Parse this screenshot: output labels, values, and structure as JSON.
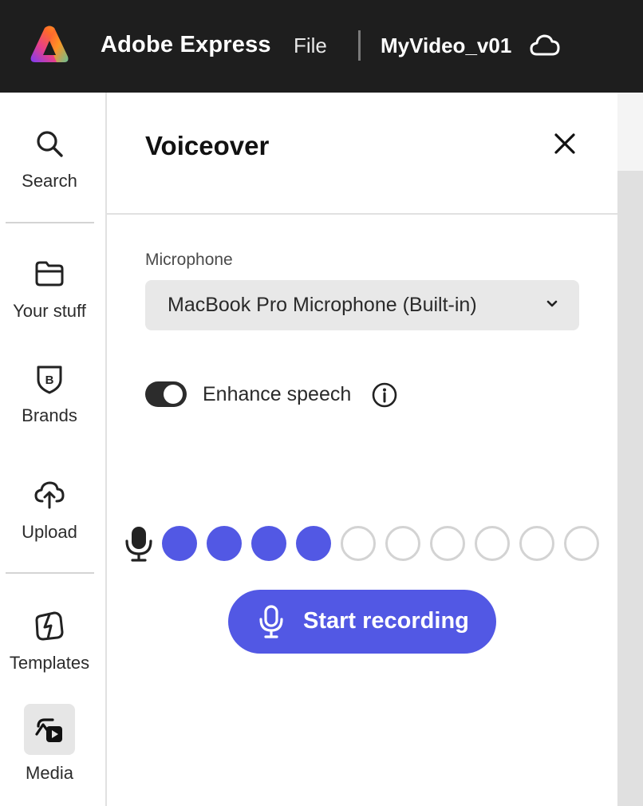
{
  "header": {
    "app_title": "Adobe Express",
    "file_menu": "File",
    "document_title": "MyVideo_v01",
    "logo_icon": "adobe-express-logo",
    "cloud_icon": "cloud-icon"
  },
  "sidebar": {
    "items": [
      {
        "label": "Search",
        "icon": "search-icon"
      },
      {
        "label": "Your stuff",
        "icon": "folder-icon"
      },
      {
        "label": "Brands",
        "icon": "brand-shield-icon"
      },
      {
        "label": "Upload",
        "icon": "upload-cloud-icon"
      },
      {
        "label": "Templates",
        "icon": "templates-icon"
      },
      {
        "label": "Media",
        "icon": "media-icon",
        "selected": true
      }
    ]
  },
  "panel": {
    "title": "Voiceover",
    "microphone_label": "Microphone",
    "microphone_value": "MacBook Pro Microphone (Built-in)",
    "enhance_speech_label": "Enhance speech",
    "enhance_speech_on": true,
    "level_meter": {
      "active": 4,
      "total": 10
    },
    "record_button_label": "Start recording"
  },
  "colors": {
    "topbar": "#1e1e1e",
    "accent": "#5258e4",
    "select_bg": "#e8e8e8"
  }
}
